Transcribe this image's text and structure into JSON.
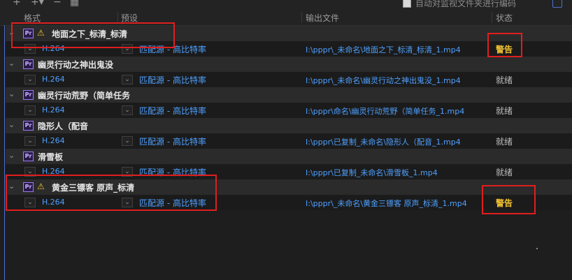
{
  "toolbar": {
    "add_icon": "+",
    "add_dropdown_icon": "+▾",
    "remove_icon": "−",
    "duplicate_icon": "▦",
    "autostart_label": "自动对监视文件夹进行编码"
  },
  "columns": {
    "format": "格式",
    "preset": "预设",
    "output": "输出文件",
    "status": "状态"
  },
  "groups": [
    {
      "title": "地面之下_标清_标清",
      "warning": true,
      "row": {
        "format": "H.264",
        "preset": "匹配源 - 高比特率",
        "output": "I:\\pppr\\_未命名\\地面之下_标清_标清_1.mp4",
        "status": "警告"
      }
    },
    {
      "title": "幽灵行动之神出鬼没",
      "warning": false,
      "row": {
        "format": "H.264",
        "preset": "匹配源 - 高比特率",
        "output": "I:\\pppr\\_未命名\\幽灵行动之神出鬼没_1.mp4",
        "status": "就绪"
      }
    },
    {
      "title": "幽灵行动荒野（简单任务",
      "warning": false,
      "row": {
        "format": "H.264",
        "preset": "匹配源 - 高比特率",
        "output": "I:\\pppr\\命名\\幽灵行动荒野（简单任务_1.mp4",
        "status": "就绪"
      }
    },
    {
      "title": "隐形人（配音",
      "warning": false,
      "row": {
        "format": "H.264",
        "preset": "匹配源 - 高比特率",
        "output": "I:\\pppr\\已复制_未命名\\隐形人（配音_1.mp4",
        "status": "就绪"
      }
    },
    {
      "title": "滑雪板",
      "warning": false,
      "row": {
        "format": "H.264",
        "preset": "匹配源 - 高比特率",
        "output": "I:\\pppr\\已复制_未命名\\滑雪板_1.mp4",
        "status": "就绪"
      }
    },
    {
      "title": "黄金三镖客 原声_标清",
      "warning": true,
      "row": {
        "format": "H.264",
        "preset": "匹配源 - 高比特率",
        "output": "I:\\pppr\\_未命名\\黄金三镖客 原声_标清_1.mp4",
        "status": "警告"
      }
    }
  ],
  "icons": {
    "premiere": "Pr",
    "warning": "⚠",
    "caret": "⌄",
    "dropdown": "⌄"
  },
  "colors": {
    "link": "#4ea0ff",
    "warning": "#f2c230",
    "highlight": "#e01e1e",
    "background": "#1e1e1e"
  }
}
